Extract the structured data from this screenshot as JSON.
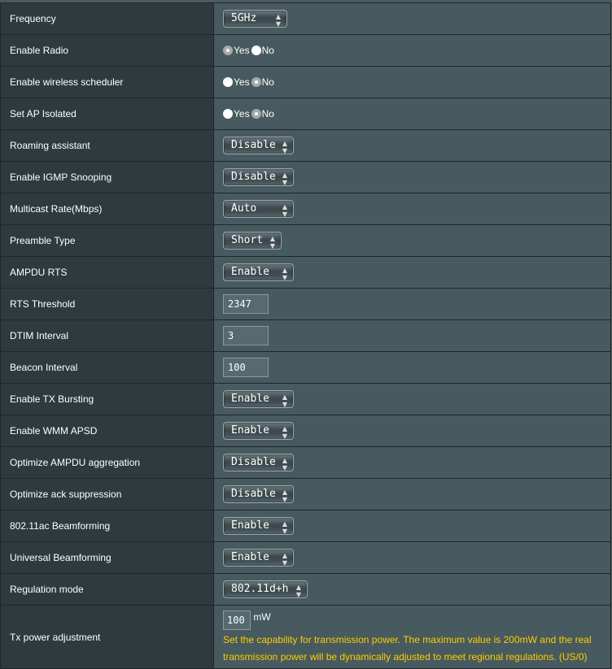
{
  "rows": [
    {
      "label": "Frequency",
      "type": "select",
      "value": "5GHz"
    },
    {
      "label": "Enable Radio",
      "type": "radio",
      "yes": "Yes",
      "no": "No",
      "selected": "Yes"
    },
    {
      "label": "Enable wireless scheduler",
      "type": "radio",
      "yes": "Yes",
      "no": "No",
      "selected": "No"
    },
    {
      "label": "Set AP Isolated",
      "type": "radio",
      "yes": "Yes",
      "no": "No",
      "selected": "No"
    },
    {
      "label": "Roaming assistant",
      "type": "select",
      "value": "Disable"
    },
    {
      "label": "Enable IGMP Snooping",
      "type": "select",
      "value": "Disable"
    },
    {
      "label": "Multicast Rate(Mbps)",
      "type": "select",
      "value": "Auto"
    },
    {
      "label": "Preamble Type",
      "type": "select",
      "value": "Short"
    },
    {
      "label": "AMPDU RTS",
      "type": "select",
      "value": "Enable"
    },
    {
      "label": "RTS Threshold",
      "type": "input",
      "value": "2347"
    },
    {
      "label": "DTIM Interval",
      "type": "input",
      "value": "3"
    },
    {
      "label": "Beacon Interval",
      "type": "input",
      "value": "100"
    },
    {
      "label": "Enable TX Bursting",
      "type": "select",
      "value": "Enable"
    },
    {
      "label": "Enable WMM APSD",
      "type": "select",
      "value": "Enable"
    },
    {
      "label": "Optimize AMPDU aggregation",
      "type": "select",
      "value": "Disable"
    },
    {
      "label": "Optimize ack suppression",
      "type": "select",
      "value": "Disable"
    },
    {
      "label": "802.11ac Beamforming",
      "type": "select",
      "value": "Enable"
    },
    {
      "label": "Universal Beamforming",
      "type": "select",
      "value": "Enable"
    },
    {
      "label": "Regulation mode",
      "type": "select",
      "value": "802.11d+h"
    }
  ],
  "tx": {
    "label": "Tx power adjustment",
    "value": "100",
    "unit": "mW",
    "hint": "Set the capability for transmission power. The maximum value is 200mW and the real transmission power will be dynamically adjusted to meet regional regulations. (US/0)"
  },
  "colors": {
    "hint": "#ffcc00",
    "label_bg": "#2e3a3e",
    "value_bg": "#475a5f"
  }
}
